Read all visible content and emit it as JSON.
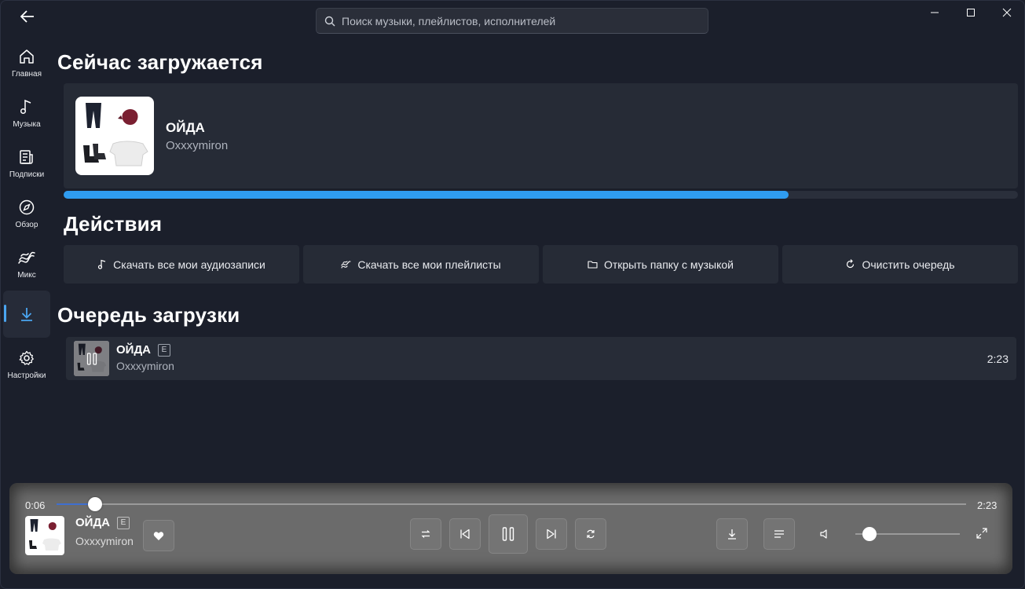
{
  "search": {
    "placeholder": "Поиск музыки, плейлистов, исполнителей"
  },
  "sidebar": {
    "items": [
      {
        "label": "Главная",
        "icon": "home-icon",
        "active": false
      },
      {
        "label": "Музыка",
        "icon": "music-note-icon",
        "active": false
      },
      {
        "label": "Подписки",
        "icon": "subscriptions-icon",
        "active": false
      },
      {
        "label": "Обзор",
        "icon": "compass-icon",
        "active": false
      },
      {
        "label": "Микс",
        "icon": "mix-waves-icon",
        "active": false
      },
      {
        "label": "",
        "icon": "download-icon",
        "active": true
      },
      {
        "label": "Настройки",
        "icon": "gear-icon",
        "active": false
      }
    ]
  },
  "now_loading": {
    "heading": "Сейчас загружается",
    "title": "ОЙДА",
    "artist": "Oxxxymiron",
    "progress": 0.76
  },
  "actions": {
    "heading": "Действия",
    "buttons": [
      {
        "label": "Скачать все мои аудиозаписи",
        "icon": "music-note-icon"
      },
      {
        "label": "Скачать все мои плейлисты",
        "icon": "mix-waves-icon"
      },
      {
        "label": "Открыть папку с музыкой",
        "icon": "folder-icon"
      },
      {
        "label": "Очистить очередь",
        "icon": "refresh-icon"
      }
    ]
  },
  "queue": {
    "heading": "Очередь загрузки",
    "items": [
      {
        "title": "ОЙДА",
        "explicit": "E",
        "artist": "Oxxxymiron",
        "duration": "2:23"
      }
    ]
  },
  "player": {
    "current_time": "0:06",
    "total_time": "2:23",
    "progress": 0.042,
    "volume": 0.07,
    "title": "ОЙДА",
    "explicit": "E",
    "artist": "Oxxxymiron"
  },
  "colors": {
    "accent": "#2f9cf0",
    "background": "#1b1f2b",
    "card": "#262b36",
    "player": "#6b6b6b"
  }
}
